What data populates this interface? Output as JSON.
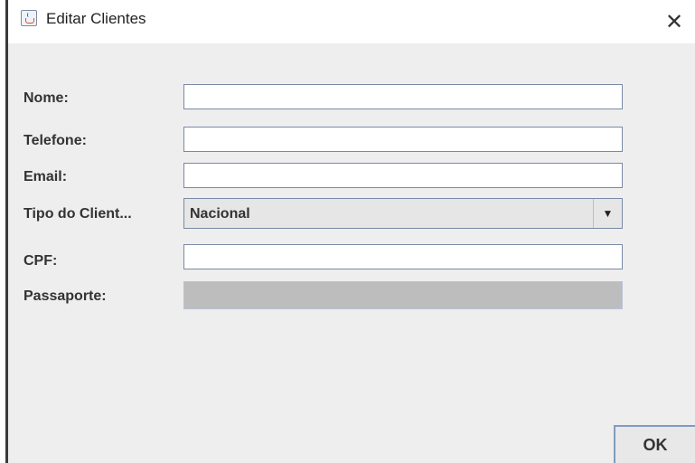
{
  "window": {
    "title": "Editar Clientes",
    "close_glyph": "✕"
  },
  "icons": {
    "app": "java-app-icon",
    "close": "close-icon",
    "dropdown": "chevron-down-icon"
  },
  "form": {
    "nome": {
      "label": "Nome:",
      "value": ""
    },
    "telefone": {
      "label": "Telefone:",
      "value": ""
    },
    "email": {
      "label": "Email:",
      "value": ""
    },
    "tipo": {
      "label": "Tipo do Client...",
      "value": "Nacional",
      "arrow": "▼"
    },
    "cpf": {
      "label": "CPF:",
      "value": ""
    },
    "passaporte": {
      "label": "Passaporte:",
      "value": "",
      "enabled": false
    }
  },
  "buttons": {
    "ok_label": "OK"
  }
}
